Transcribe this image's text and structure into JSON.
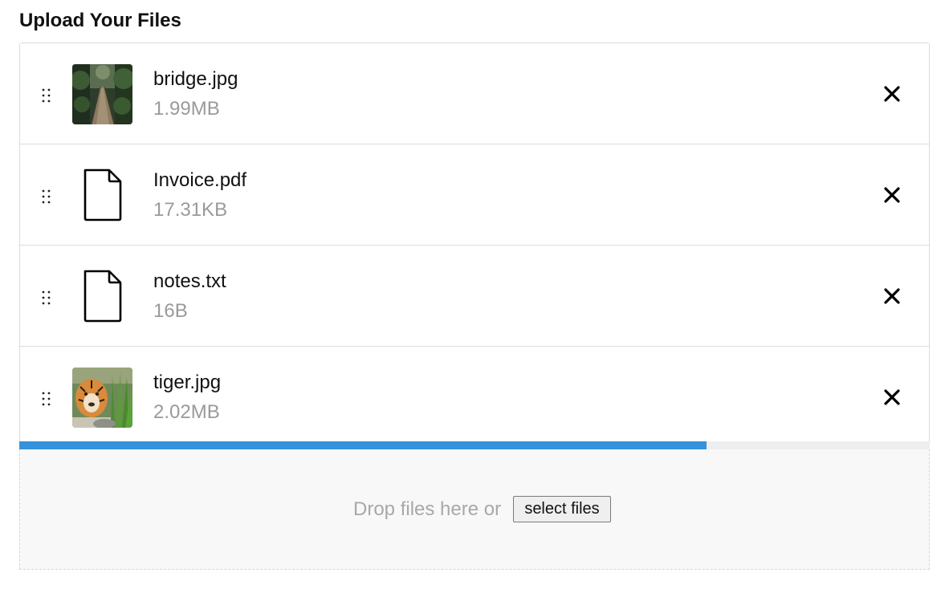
{
  "page": {
    "title": "Upload Your Files"
  },
  "files": [
    {
      "name": "bridge.jpg",
      "size": "1.99MB",
      "kind": "image",
      "icon": "bridge-photo-thumbnail"
    },
    {
      "name": "Invoice.pdf",
      "size": "17.31KB",
      "kind": "document",
      "icon": "document-icon"
    },
    {
      "name": "notes.txt",
      "size": "16B",
      "kind": "document",
      "icon": "document-icon"
    },
    {
      "name": "tiger.jpg",
      "size": "2.02MB",
      "kind": "image",
      "icon": "tiger-photo-thumbnail"
    }
  ],
  "upload_progress": {
    "fraction": 0.755,
    "color": "#3591d9"
  },
  "dropzone": {
    "text": "Drop files here or",
    "button_label": "select files"
  },
  "icons": {
    "drag_handle": "drag-handle-icon",
    "remove": "close-icon"
  }
}
